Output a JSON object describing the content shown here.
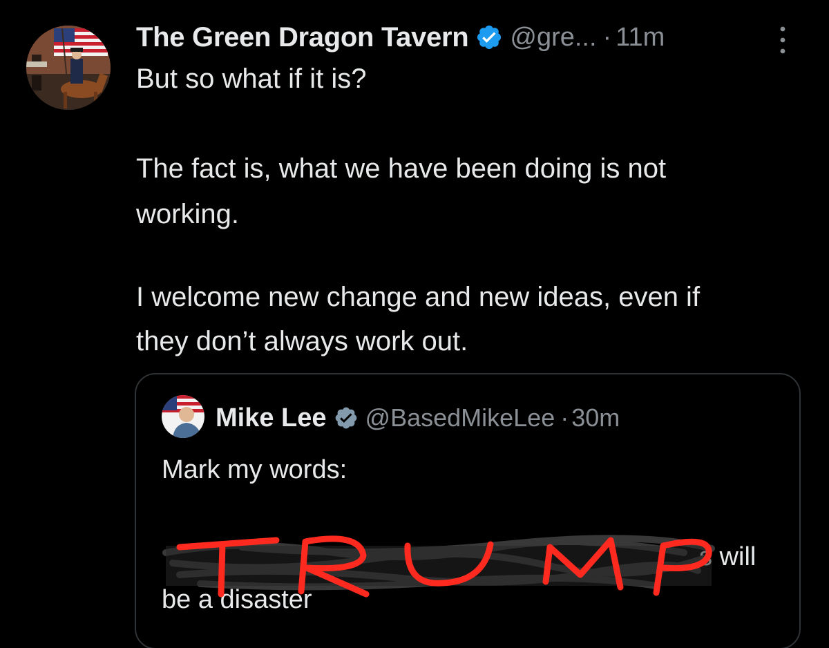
{
  "tweet": {
    "display_name": "The Green Dragon Tavern",
    "handle": "@gre...",
    "separator": "·",
    "timestamp": "11m",
    "lines": [
      "But so what if it is?",
      "The fact is, what we have been doing is not",
      "working.",
      "I welcome new change and new ideas, even if",
      "they don’t always work out."
    ]
  },
  "quoted_tweet": {
    "display_name": "Mike Lee",
    "handle": "@BasedMikeLee",
    "separator": "·",
    "timestamp": "30m",
    "lines": [
      "Mark my words:",
      "s will",
      "be a disaster"
    ],
    "handwritten_overlay": "TRUMP"
  },
  "icons": {
    "verified": "verified-badge-icon",
    "more": "more-options-icon"
  },
  "colors": {
    "background": "#000000",
    "text": "#e7e9ea",
    "secondary_text": "#8b9096",
    "verified_blue": "#1d9bf0",
    "verified_grey": "#829aab",
    "card_border": "#2f3336",
    "scribble_red": "#ff2a1f"
  }
}
